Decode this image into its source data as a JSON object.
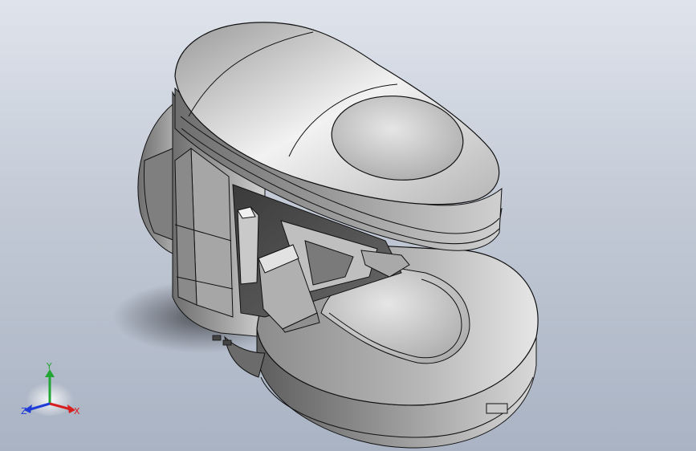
{
  "viewport": {
    "background_top": "#dfe4ec",
    "background_bottom": "#a9b3c3",
    "model_color": "#8a8a8a",
    "edge_color": "#111111"
  },
  "triad": {
    "x_label": "X",
    "y_label": "Y",
    "z_label": "Z",
    "x_color": "#d81f1f",
    "y_color": "#22a534",
    "z_color": "#1f3bd8"
  }
}
